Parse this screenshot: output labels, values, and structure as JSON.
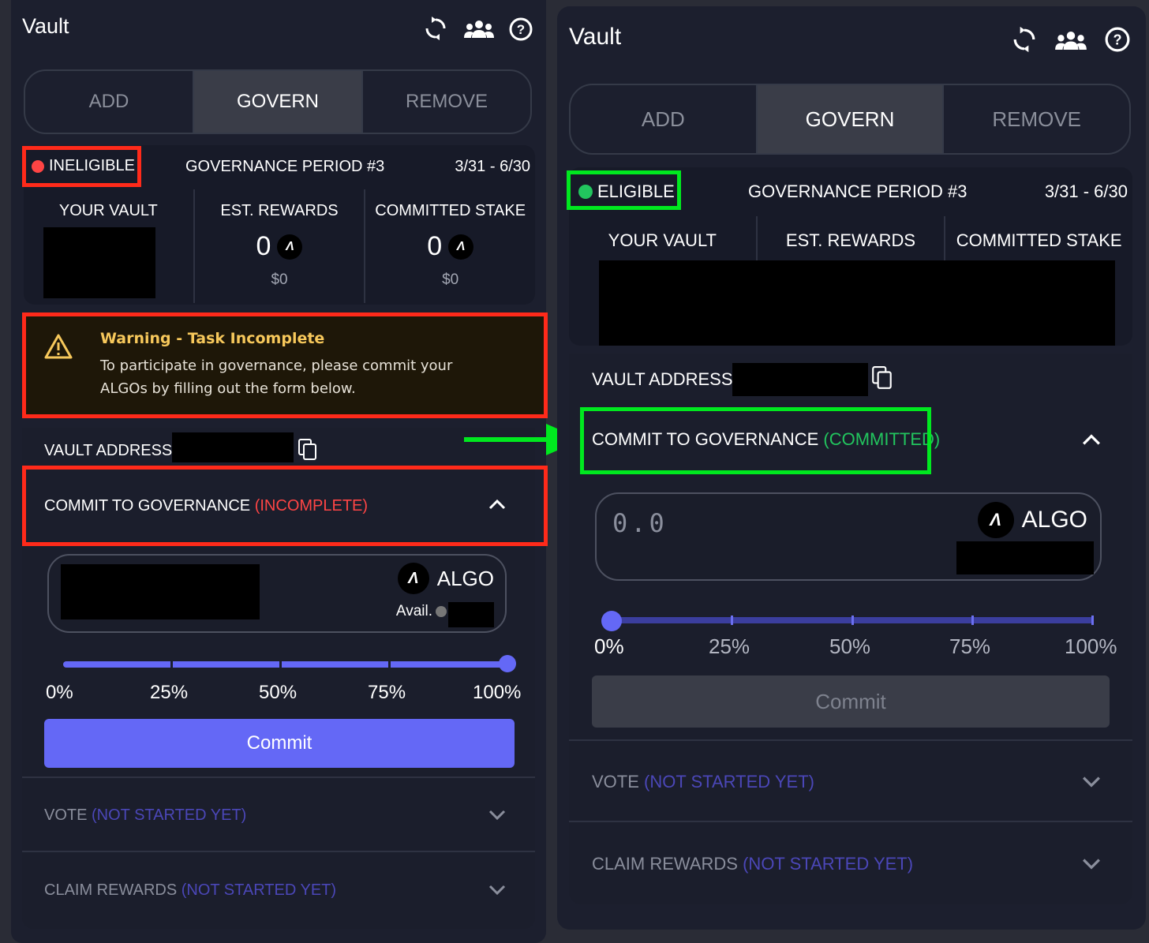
{
  "colors": {
    "accent": "#6468f6",
    "ineligible": "#ff4444",
    "eligible": "#22c55e",
    "warning": "#f7c85b",
    "highlight_red": "#ff2a1a",
    "highlight_green": "#00e81f"
  },
  "left": {
    "title": "Vault",
    "icons": [
      "refresh-icon",
      "users-icon",
      "help-icon"
    ],
    "tabs": [
      "ADD",
      "GOVERN",
      "REMOVE"
    ],
    "status": "INELIGIBLE",
    "period": "GOVERNANCE PERIOD #3",
    "dates": "3/31 - 6/30",
    "stats": {
      "vault": "YOUR VAULT",
      "rewards": "EST. REWARDS",
      "stake": "COMMITTED STAKE",
      "rewards_val": "0",
      "stake_val": "0",
      "rewards_usd": "$0",
      "stake_usd": "$0"
    },
    "warning": {
      "title": "Warning - Task Incomplete",
      "line1": "To participate in governance, please commit your",
      "line2": "ALGOs by filling out the form below."
    },
    "vault_address": "VAULT ADDRESS:",
    "commit_label": "COMMIT TO GOVERNANCE",
    "commit_status": "(INCOMPLETE)",
    "currency": "ALGO",
    "avail": "Avail.",
    "percents": [
      "0%",
      "25%",
      "50%",
      "75%",
      "100%"
    ],
    "slider_value": 1.0,
    "commit_button": "Commit",
    "vote_label": "VOTE",
    "vote_status": "(NOT STARTED YET)",
    "claim_label": "CLAIM REWARDS",
    "claim_status": "(NOT STARTED YET)"
  },
  "right": {
    "title": "Vault",
    "tabs": [
      "ADD",
      "GOVERN",
      "REMOVE"
    ],
    "status": "ELIGIBLE",
    "period": "GOVERNANCE PERIOD #3",
    "dates": "3/31 - 6/30",
    "stats": {
      "vault": "YOUR VAULT",
      "rewards": "EST. REWARDS",
      "stake": "COMMITTED STAKE"
    },
    "vault_address": "VAULT ADDRESS:",
    "commit_label": "COMMIT TO GOVERNANCE",
    "commit_status": "(COMMITTED)",
    "amount_placeholder": "0.0",
    "currency": "ALGO",
    "percents": [
      "0%",
      "25%",
      "50%",
      "75%",
      "100%"
    ],
    "slider_value": 0.0,
    "commit_button": "Commit",
    "vote_label": "VOTE",
    "vote_status": "(NOT STARTED YET)",
    "claim_label": "CLAIM REWARDS",
    "claim_status": "(NOT STARTED YET)"
  }
}
